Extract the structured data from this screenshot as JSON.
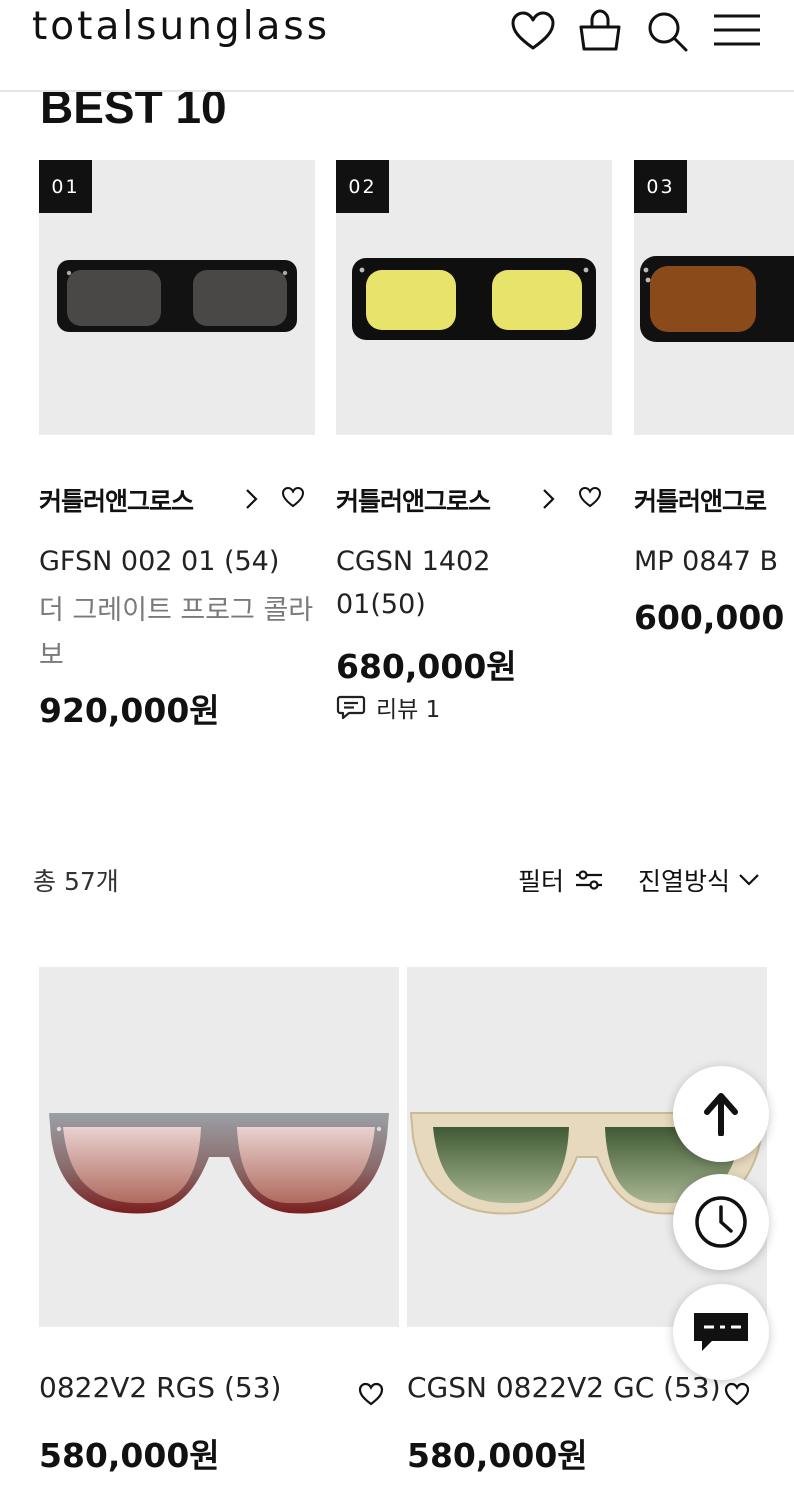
{
  "header": {
    "logo": "totalsunglass",
    "icons": [
      "heart-icon",
      "bag-icon",
      "search-icon",
      "menu-icon"
    ]
  },
  "best": {
    "title": "BEST 10",
    "items": [
      {
        "rank": "01",
        "brand": "커틀러앤그로스",
        "name": "GFSN 002 01 (54)",
        "desc": "더 그레이트 프로그 콜라보",
        "price": "920,000원"
      },
      {
        "rank": "02",
        "brand": "커틀러앤그로스",
        "name": "CGSN 1402",
        "name2": "01(50)",
        "price": "680,000원",
        "review": "리뷰 1"
      },
      {
        "rank": "03",
        "brand": "커틀러앤그로",
        "name": "MP 0847 B",
        "price": "600,000"
      }
    ]
  },
  "listing": {
    "count": "총 57개",
    "filter_label": "필터",
    "sort_label": "진열방식"
  },
  "products": [
    {
      "name": "0822V2 RGS (53)",
      "price": "580,000원"
    },
    {
      "name": "CGSN 0822V2 GC (53)",
      "price": "580,000원"
    }
  ],
  "floating": [
    "arrow-up-icon",
    "clock-icon",
    "chat-icon"
  ],
  "colors": {
    "text": "#111111",
    "muted": "#7a7a7a",
    "image_bg": "#ebebeb",
    "badge": "#111111"
  }
}
